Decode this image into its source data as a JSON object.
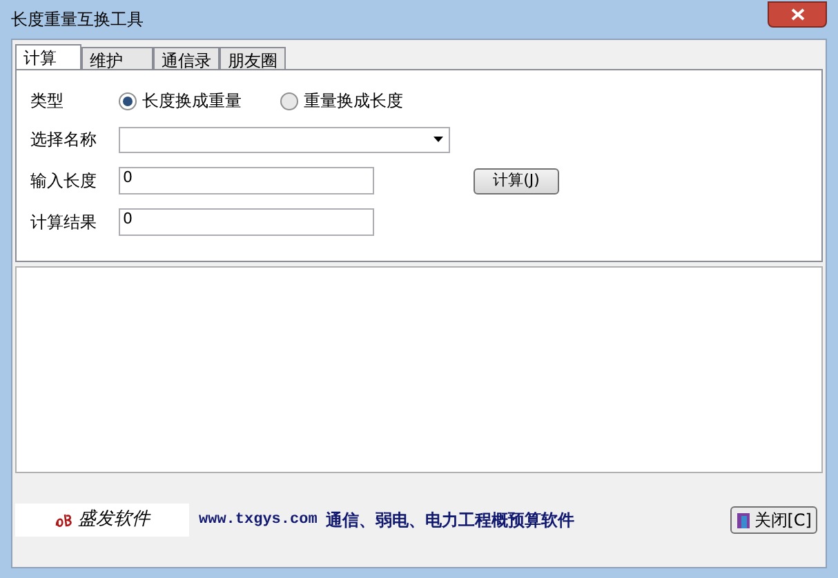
{
  "window": {
    "title": "长度重量互换工具"
  },
  "tabs": [
    {
      "label": "计算",
      "selected": true
    },
    {
      "label": "维护",
      "selected": false
    },
    {
      "label": "通信录",
      "selected": false
    },
    {
      "label": "朋友圈",
      "selected": false
    }
  ],
  "type": {
    "label": "类型",
    "options": [
      {
        "label": "长度换成重量",
        "selected": true
      },
      {
        "label": "重量换成长度",
        "selected": false
      }
    ]
  },
  "name_select": {
    "label": "选择名称"
  },
  "length_input": {
    "label": "输入长度",
    "value": "0"
  },
  "calc_button": "计算(J)",
  "result": {
    "label": "计算结果",
    "value": "0"
  },
  "footer": {
    "brand": "盛发软件",
    "url": "www.txgys.com",
    "slogan": "通信、弱电、电力工程概预算软件",
    "close_button": "关闭[C]"
  }
}
